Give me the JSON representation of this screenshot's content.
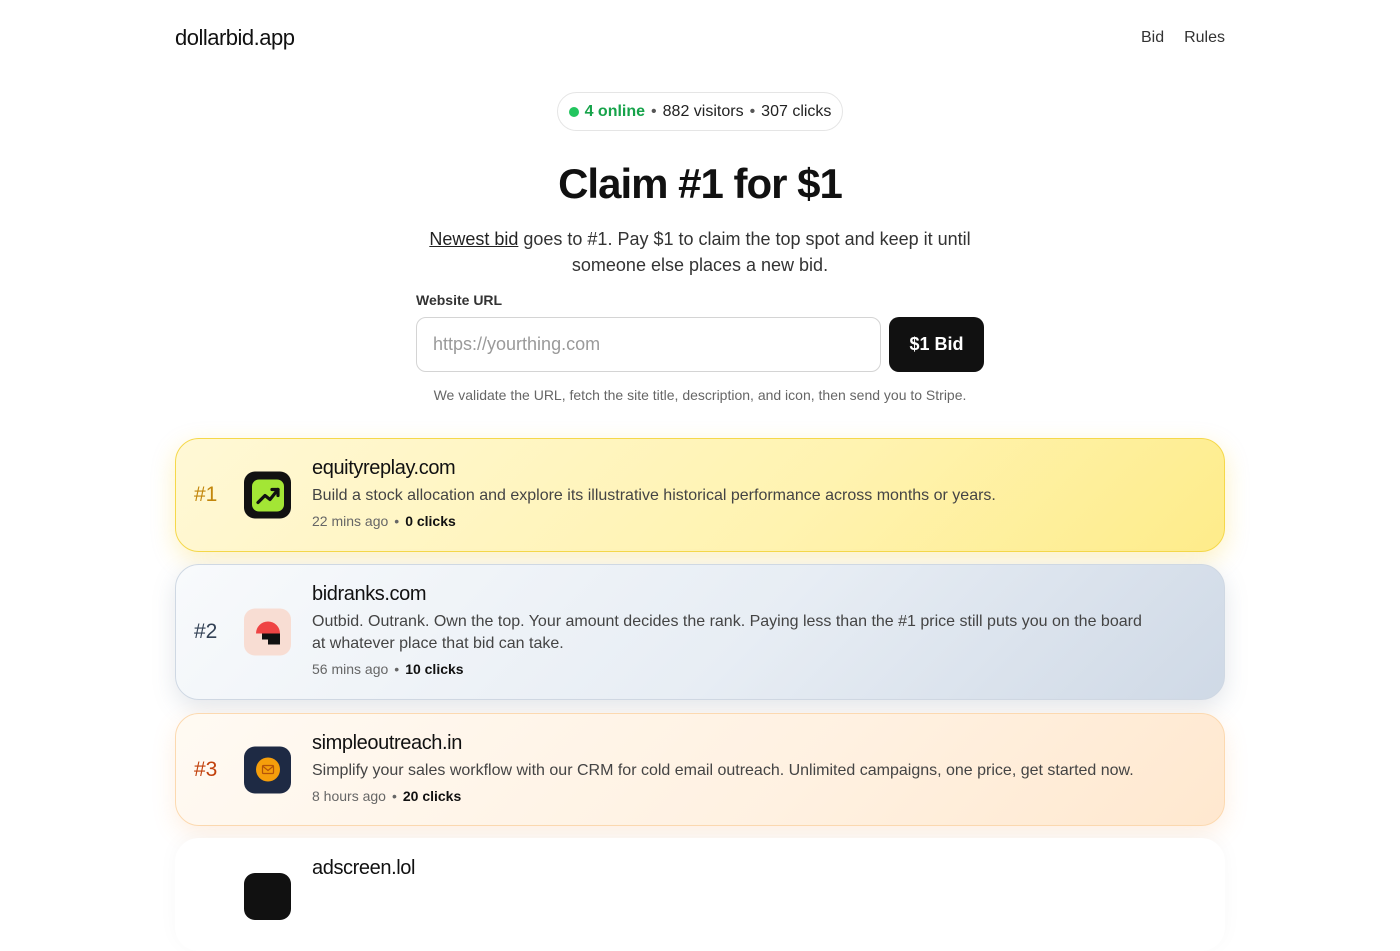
{
  "header": {
    "brand": "dollarbid.app",
    "nav": [
      "Bid",
      "Rules"
    ]
  },
  "stats": {
    "online": "4 online",
    "visitors": "882 visitors",
    "clicks": "307 clicks",
    "separator": "•"
  },
  "hero": {
    "title": "Claim #1 for $1",
    "sub_link": "Newest bid",
    "sub_text": " goes to #1. Pay $1 to claim the top spot and keep it until someone else places a new bid."
  },
  "form": {
    "label": "Website URL",
    "placeholder": "https://yourthing.com",
    "value": "",
    "button": "$1 Bid",
    "hint": "We validate the URL, fetch the site title, description, and icon, then send you to Stripe."
  },
  "listings": [
    {
      "rank": "#1",
      "site": "equityreplay.com",
      "desc": "Build a stock allocation and explore its illustrative historical performance across months or years.",
      "time": "22 mins ago",
      "clicks": "0 clicks",
      "icon": "chart-trending-up-icon"
    },
    {
      "rank": "#2",
      "site": "bidranks.com",
      "desc": "Outbid. Outrank. Own the top. Your amount decides the rank. Paying less than the #1 price still puts you on the board at whatever place that bid can take.",
      "time": "56 mins ago",
      "clicks": "10 clicks",
      "icon": "bidranks-logo-icon"
    },
    {
      "rank": "#3",
      "site": "simpleoutreach.in",
      "desc": "Simplify your sales workflow with our CRM for cold email outreach. Unlimited campaigns, one price, get started now.",
      "time": "8 hours ago",
      "clicks": "20 clicks",
      "icon": "mail-circle-icon"
    },
    {
      "rank": "",
      "site": "adscreen.lol",
      "desc": "",
      "time": "",
      "clicks": "",
      "icon": "adscreen-logo-icon"
    }
  ],
  "colors": {
    "accent_dark": "#111111",
    "online_green": "#16a34a",
    "rank1_gold": "#c2860b",
    "rank2_slate": "#334155",
    "rank3_orange": "#c2410c"
  }
}
